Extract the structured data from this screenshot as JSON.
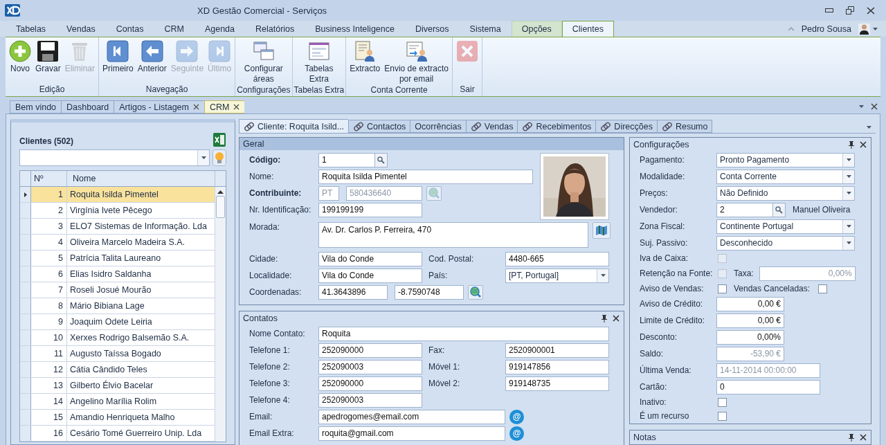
{
  "window": {
    "title": "XD Gestão Comercial - Serviços"
  },
  "menu_tabs": [
    {
      "label": "Tabelas",
      "selected": false,
      "contextual": false
    },
    {
      "label": "Vendas",
      "selected": false,
      "contextual": false
    },
    {
      "label": "Contas",
      "selected": false,
      "contextual": false
    },
    {
      "label": "CRM",
      "selected": false,
      "contextual": false
    },
    {
      "label": "Agenda",
      "selected": false,
      "contextual": false
    },
    {
      "label": "Relatórios",
      "selected": false,
      "contextual": false
    },
    {
      "label": "Business Inteligence",
      "selected": false,
      "contextual": false
    },
    {
      "label": "Diversos",
      "selected": false,
      "contextual": false
    },
    {
      "label": "Sistema",
      "selected": false,
      "contextual": false
    },
    {
      "label": "Opções",
      "selected": false,
      "contextual": true
    },
    {
      "label": "Clientes",
      "selected": true,
      "contextual": true
    }
  ],
  "user": {
    "name": "Pedro Sousa"
  },
  "ribbon": [
    {
      "label": "Edição",
      "buttons": [
        {
          "label": "Novo",
          "kind": "add",
          "disabled": false
        },
        {
          "label": "Gravar",
          "kind": "save",
          "disabled": false
        },
        {
          "label": "Eliminar",
          "kind": "trash",
          "disabled": true
        }
      ]
    },
    {
      "label": "Navegação",
      "buttons": [
        {
          "label": "Primeiro",
          "kind": "first",
          "disabled": false
        },
        {
          "label": "Anterior",
          "kind": "prev",
          "disabled": false
        },
        {
          "label": "Seguinte",
          "kind": "next",
          "disabled": true
        },
        {
          "label": "Último",
          "kind": "last",
          "disabled": true
        }
      ]
    },
    {
      "label": "Configurações",
      "buttons": [
        {
          "label": "Configurar\náreas",
          "kind": "windows",
          "disabled": false
        }
      ]
    },
    {
      "label": "Tabelas Extra",
      "buttons": [
        {
          "label": "Tabelas\nExtra",
          "kind": "form",
          "disabled": false
        }
      ]
    },
    {
      "label": "Conta Corrente",
      "buttons": [
        {
          "label": "Extracto",
          "kind": "statement",
          "disabled": false
        },
        {
          "label": "Envio de extracto\npor email",
          "kind": "mail",
          "disabled": false
        }
      ]
    },
    {
      "label": "Sair",
      "buttons": [
        {
          "kind": "close",
          "disabled": true
        }
      ]
    }
  ],
  "doc_tabs": [
    {
      "label": "Bem vindo",
      "selected": false,
      "closable": false
    },
    {
      "label": "Dashboard",
      "selected": false,
      "closable": false
    },
    {
      "label": "Artigos - Listagem",
      "selected": false,
      "closable": true
    },
    {
      "label": "CRM",
      "selected": true,
      "closable": true
    }
  ],
  "clients": {
    "title": "Clientes (502)",
    "columns": [
      "Nº",
      "Nome"
    ],
    "rows": [
      {
        "number": "1",
        "name": "Roquita Isilda Pimentel",
        "selected": true
      },
      {
        "number": "2",
        "name": "Virgínia Ivete Pêcego",
        "selected": false
      },
      {
        "number": "3",
        "name": "ELO7 Sistemas de Informação. Lda",
        "selected": false
      },
      {
        "number": "4",
        "name": "Oliveira Marcelo Madeira S.A.",
        "selected": false
      },
      {
        "number": "5",
        "name": "Patrícia Talita Laureano",
        "selected": false
      },
      {
        "number": "6",
        "name": "Elias Isidro Saldanha",
        "selected": false
      },
      {
        "number": "7",
        "name": "Roseli Josué Mourão",
        "selected": false
      },
      {
        "number": "8",
        "name": "Mário Bibiana Lage",
        "selected": false
      },
      {
        "number": "9",
        "name": "Joaquim Odete Leiria",
        "selected": false
      },
      {
        "number": "10",
        "name": "Xerxes Rodrigo Balsemão S.A.",
        "selected": false
      },
      {
        "number": "11",
        "name": "Augusto Taíssa Bogado",
        "selected": false
      },
      {
        "number": "12",
        "name": "Cátia Cândido Teles",
        "selected": false
      },
      {
        "number": "13",
        "name": "Gilberto Élvio Bacelar",
        "selected": false
      },
      {
        "number": "14",
        "name": "Angelino Marília Rolim",
        "selected": false
      },
      {
        "number": "15",
        "name": "Amandio Henriqueta Malho",
        "selected": false
      },
      {
        "number": "16",
        "name": "Cesário Tomé Guerreiro Unip. Lda",
        "selected": false
      }
    ]
  },
  "record_tabs": [
    {
      "label": "Cliente: Roquita Isild...",
      "selected": true,
      "icon": true
    },
    {
      "label": "Contactos",
      "selected": false,
      "icon": true
    },
    {
      "label": "Ocorrências",
      "selected": false,
      "icon": false
    },
    {
      "label": "Vendas",
      "selected": false,
      "icon": true
    },
    {
      "label": "Recebimentos",
      "selected": false,
      "icon": true
    },
    {
      "label": "Direcções",
      "selected": false,
      "icon": true
    },
    {
      "label": "Resumo",
      "selected": false,
      "icon": true
    }
  ],
  "geral": {
    "title": "Geral",
    "rows": [
      {
        "kind": "lookup",
        "label": "Código:",
        "bold": true,
        "value": "1"
      },
      {
        "kind": "longtext",
        "label": "Nome:",
        "bold": false,
        "value": "Roquita Isilda Pimentel"
      },
      {
        "kind": "vat",
        "label": "Contribuinte:",
        "bold": true,
        "prefix": "PT",
        "value": "580436640",
        "disabled": true
      },
      {
        "kind": "text",
        "label": "Nr. Identificação:",
        "bold": false,
        "value": "199199199"
      },
      {
        "kind": "memo",
        "label": "Morada:",
        "bold": false,
        "value": "Av. Dr. Carlos P. Ferreira, 470"
      },
      {
        "kind": "pair",
        "label": "Cidade:",
        "bold": false,
        "value": "Vila do Conde",
        "label2": "Cod. Postal:",
        "value2": "4480-665",
        "dropdown": false
      },
      {
        "kind": "pair",
        "label": "Localidade:",
        "bold": false,
        "value": "Vila do Conde",
        "label2": "País:",
        "value2": "[PT, Portugal]",
        "dropdown": true
      },
      {
        "kind": "coords",
        "label": "Coordenadas:",
        "bold": false,
        "value": "41.3643896",
        "value2": "-8.7590748"
      }
    ]
  },
  "contatos": {
    "title": "Contatos",
    "rows": [
      {
        "kind": "full",
        "label": "Nome Contato:",
        "value": "Roquita"
      },
      {
        "kind": "pair",
        "label": "Telefone 1:",
        "value": "252090000",
        "label2": "Fax:",
        "value2": "2520900001"
      },
      {
        "kind": "pair",
        "label": "Telefone 2:",
        "value": "252090003",
        "label2": "Móvel 1:",
        "value2": "919147856"
      },
      {
        "kind": "pair",
        "label": "Telefone 3:",
        "value": "252090000",
        "label2": "Móvel 2:",
        "value2": "919148735"
      },
      {
        "kind": "text",
        "label": "Telefone 4:",
        "value": "252090003"
      },
      {
        "kind": "email",
        "label": "Email:",
        "value": "apedrogomes@email.com",
        "button": "@"
      },
      {
        "kind": "email",
        "label": "Email Extra:",
        "value": "roquita@gmail.com",
        "button": "@"
      }
    ]
  },
  "configuracoes": {
    "title": "Configurações",
    "rows": [
      {
        "kind": "combo",
        "label": "Pagamento:",
        "value": "Pronto Pagamento"
      },
      {
        "kind": "combo",
        "label": "Modalidade:",
        "value": "Conta Corrente"
      },
      {
        "kind": "combo",
        "label": "Preços:",
        "value": "Não Definido"
      },
      {
        "kind": "lookup",
        "label": "Vendedor:",
        "value": "2",
        "note": "Manuel Oliveira"
      },
      {
        "kind": "combo",
        "label": "Zona Fiscal:",
        "value": "Continente Portugal"
      },
      {
        "kind": "combo",
        "label": "Suj. Passivo:",
        "value": "Desconhecido"
      },
      {
        "kind": "check",
        "label": "Iva de Caixa:",
        "checked": false,
        "disabled": true
      },
      {
        "kind": "checkrate",
        "label": "Retenção na Fonte:",
        "checked": false,
        "disabled": true,
        "label2": "Taxa:",
        "value2": "0,00%"
      },
      {
        "kind": "checkpair",
        "label": "Aviso de Vendas:",
        "checked": false,
        "label2": "Vendas Canceladas:",
        "checked2": false
      },
      {
        "kind": "amount",
        "label": "Aviso de Crédito:",
        "value": "0,00 €",
        "disabled": false
      },
      {
        "kind": "amount",
        "label": "Limite de Crédito:",
        "value": "0,00 €",
        "disabled": false
      },
      {
        "kind": "amount",
        "label": "Desconto:",
        "value": "0,00%",
        "disabled": false
      },
      {
        "kind": "amount",
        "label": "Saldo:",
        "value": "-53,90 €",
        "disabled": true
      },
      {
        "kind": "date",
        "label": "Última Venda:",
        "value": "14-11-2014 00:00:00",
        "disabled": true
      },
      {
        "kind": "date",
        "label": "Cartão:",
        "value": "0",
        "disabled": false
      },
      {
        "kind": "check",
        "label": "Inativo:",
        "checked": false,
        "disabled": false
      },
      {
        "kind": "check",
        "label": "É um recurso",
        "checked": false,
        "disabled": false
      }
    ]
  },
  "notas": {
    "title": "Notas"
  }
}
